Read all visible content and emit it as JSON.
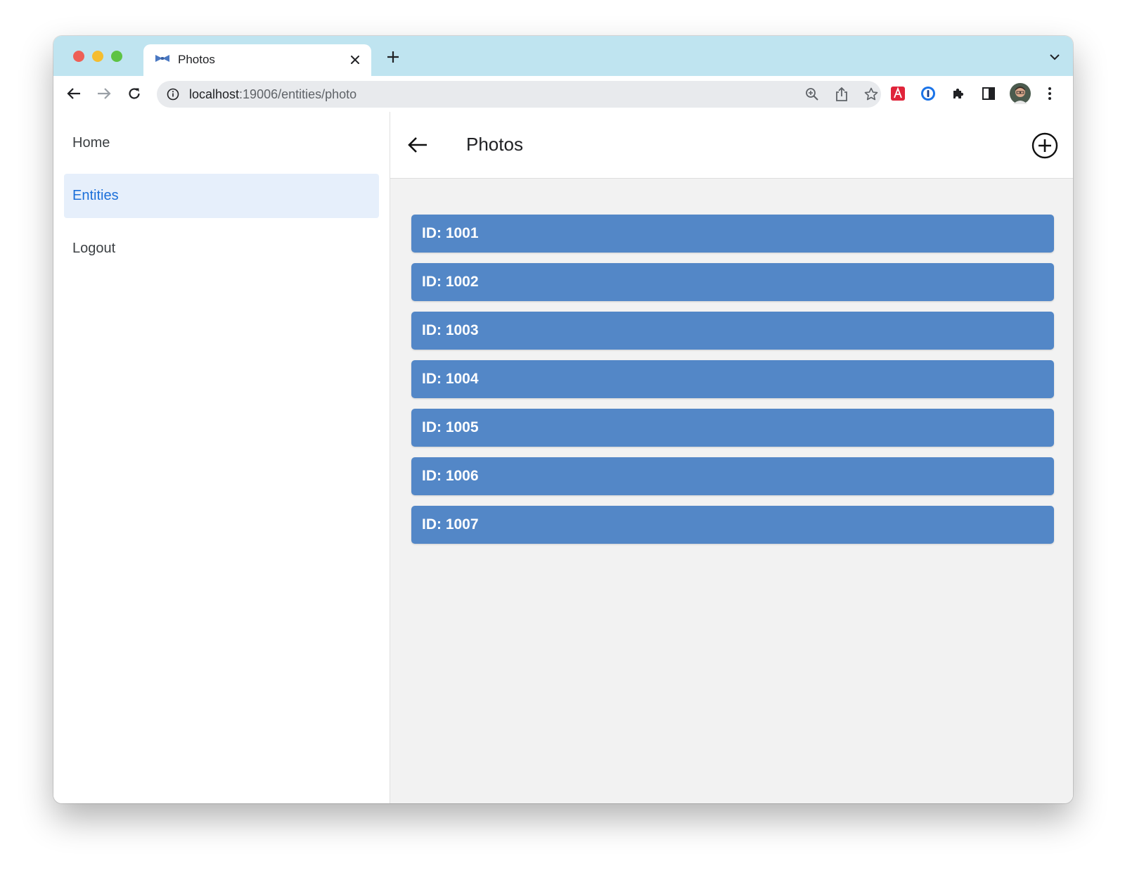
{
  "browser": {
    "tab": {
      "title": "Photos"
    },
    "address": {
      "host": "localhost",
      "path": ":19006/entities/photo"
    },
    "colors": {
      "tabstrip": "#bfe4f0",
      "accent": "#1b6fd9"
    }
  },
  "sidebar": {
    "items": [
      {
        "label": "Home",
        "active": false
      },
      {
        "label": "Entities",
        "active": true
      },
      {
        "label": "Logout",
        "active": false
      }
    ]
  },
  "appbar": {
    "title": "Photos"
  },
  "photos": [
    {
      "label": "ID: 1001"
    },
    {
      "label": "ID: 1002"
    },
    {
      "label": "ID: 1003"
    },
    {
      "label": "ID: 1004"
    },
    {
      "label": "ID: 1005"
    },
    {
      "label": "ID: 1006"
    },
    {
      "label": "ID: 1007"
    }
  ],
  "icons": {
    "favicon": "bowtie-icon",
    "back": "arrow-left-icon",
    "add": "plus-circle-icon"
  }
}
